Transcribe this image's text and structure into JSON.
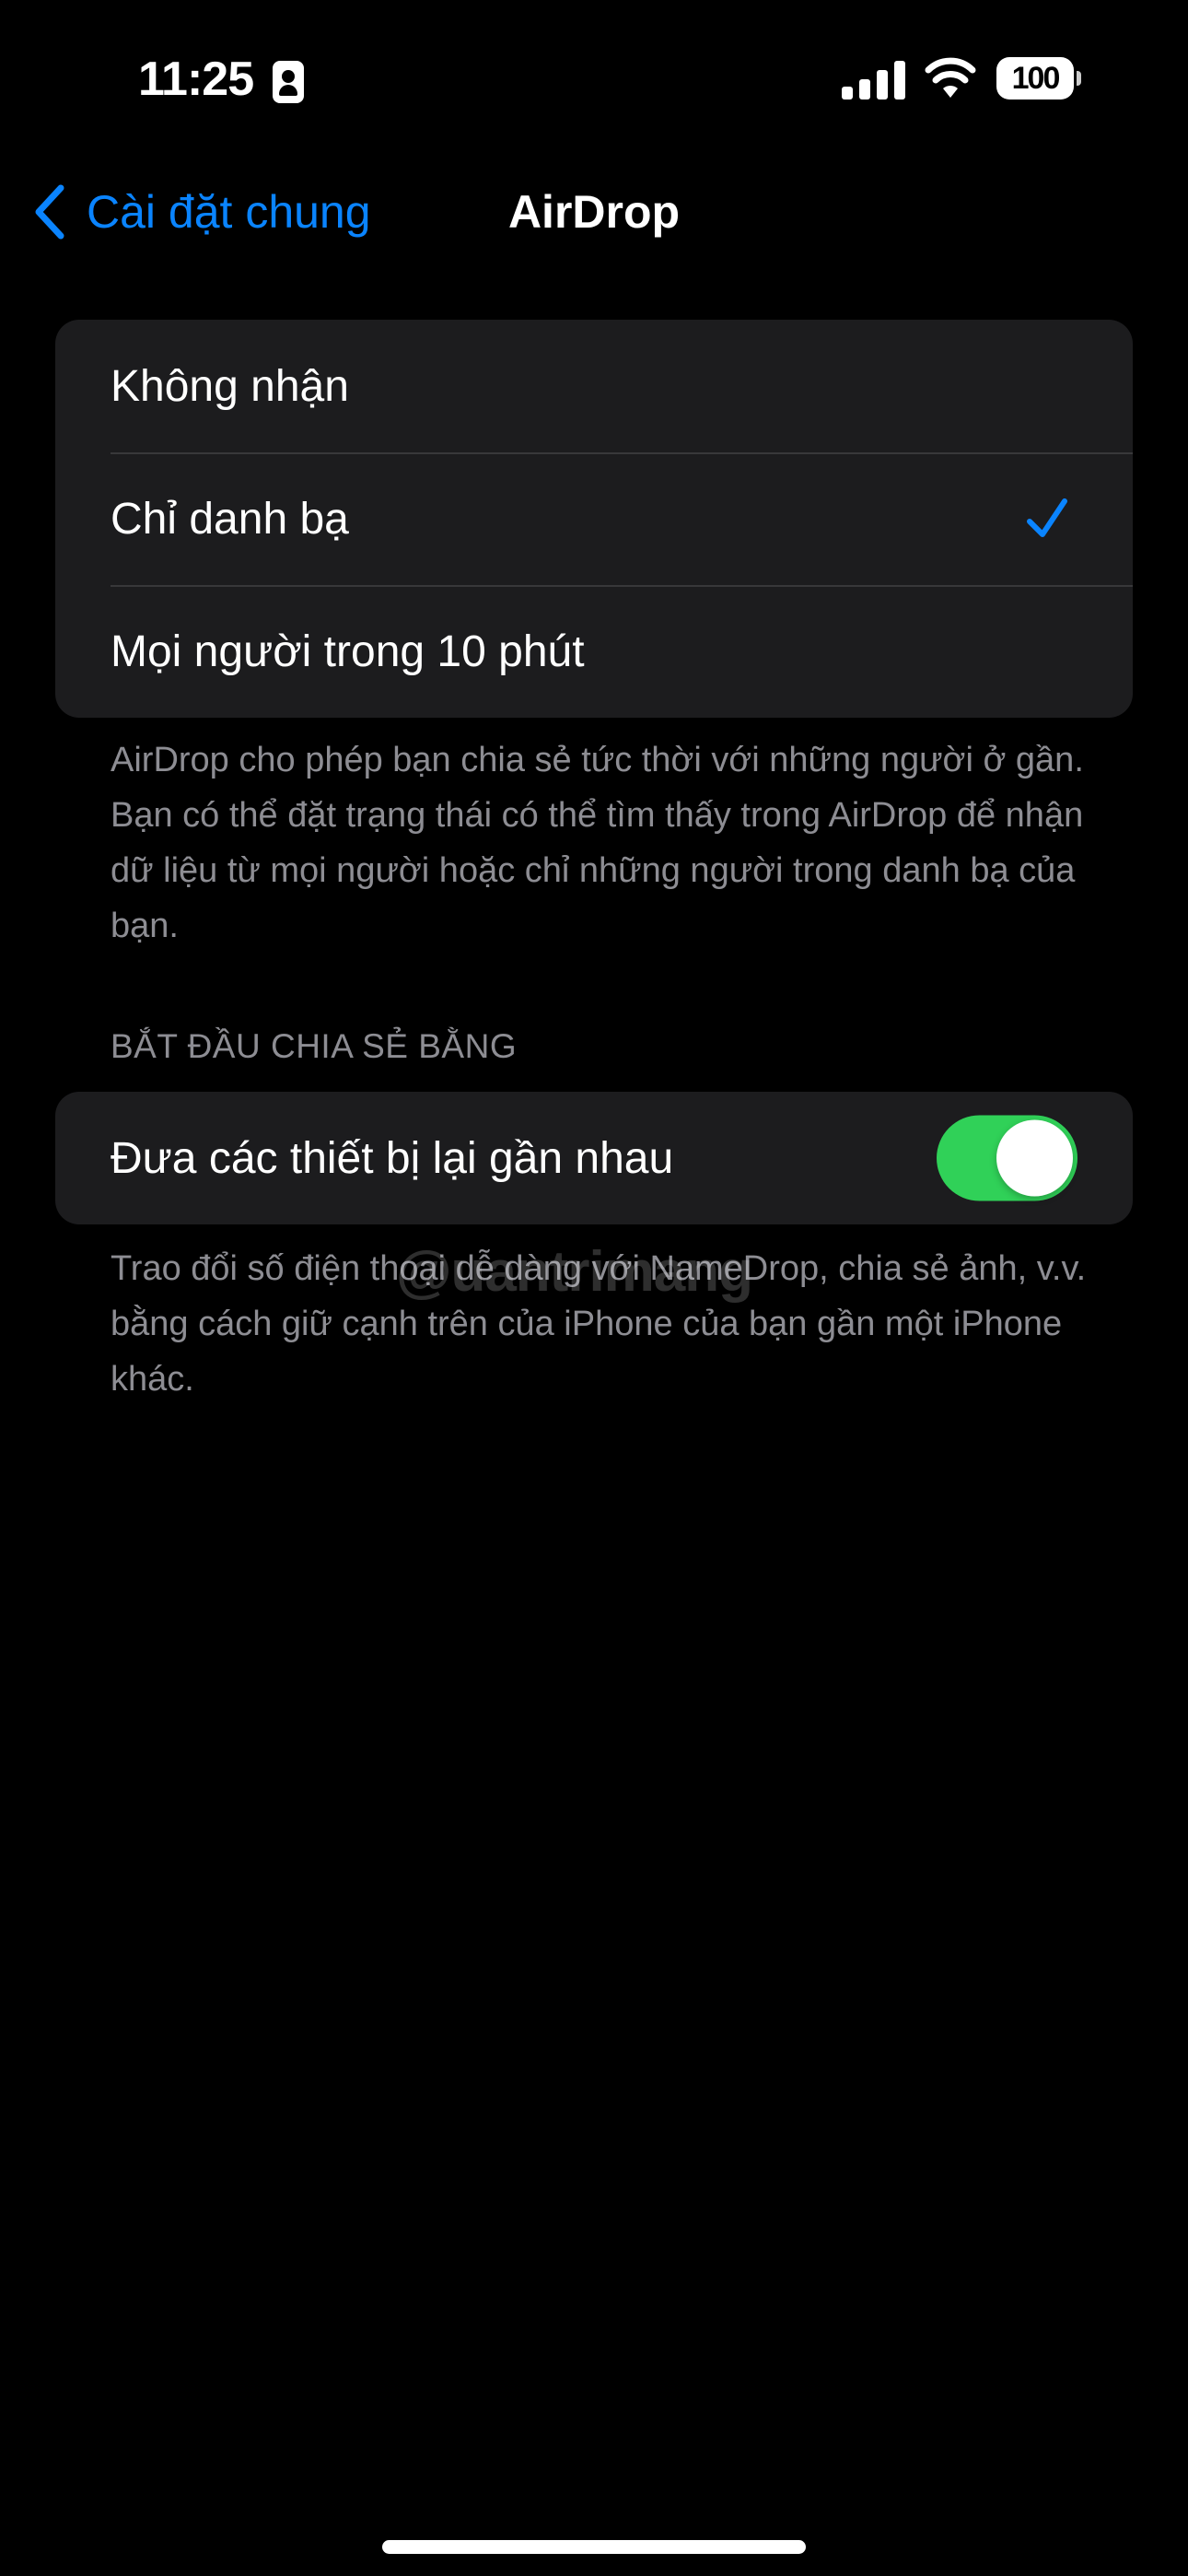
{
  "status_bar": {
    "time": "11:25",
    "focus_icon": "person-focus-icon",
    "signal_icon": "cellular-signal-icon",
    "wifi_icon": "wifi-icon",
    "battery_level": "100"
  },
  "nav": {
    "back_icon": "chevron-left-icon",
    "back_label": "Cài đặt chung",
    "title": "AirDrop"
  },
  "receiving": {
    "options": [
      {
        "label": "Không nhận",
        "selected": false
      },
      {
        "label": "Chỉ danh bạ",
        "selected": true
      },
      {
        "label": "Mọi người trong 10 phút",
        "selected": false
      }
    ],
    "footer": "AirDrop cho phép bạn chia sẻ tức thời với những người ở gần. Bạn có thể đặt trạng thái có thể tìm thấy trong AirDrop để nhận dữ liệu từ mọi người hoặc chỉ những người trong danh bạ của bạn."
  },
  "start_sharing": {
    "header": "BẮT ĐẦU CHIA SẺ BẰNG",
    "toggle_label": "Đưa các thiết bị lại gần nhau",
    "toggle_on": true,
    "footer": "Trao đổi số điện thoại dễ dàng với NameDrop, chia sẻ ảnh, v.v. bằng cách giữ cạnh trên của iPhone của bạn gần một iPhone khác."
  },
  "watermark": "@uantrimang",
  "colors": {
    "accent": "#0a84ff",
    "toggle_on": "#30d158",
    "group_bg": "#1c1c1e",
    "secondary_text": "#8d8d93"
  }
}
